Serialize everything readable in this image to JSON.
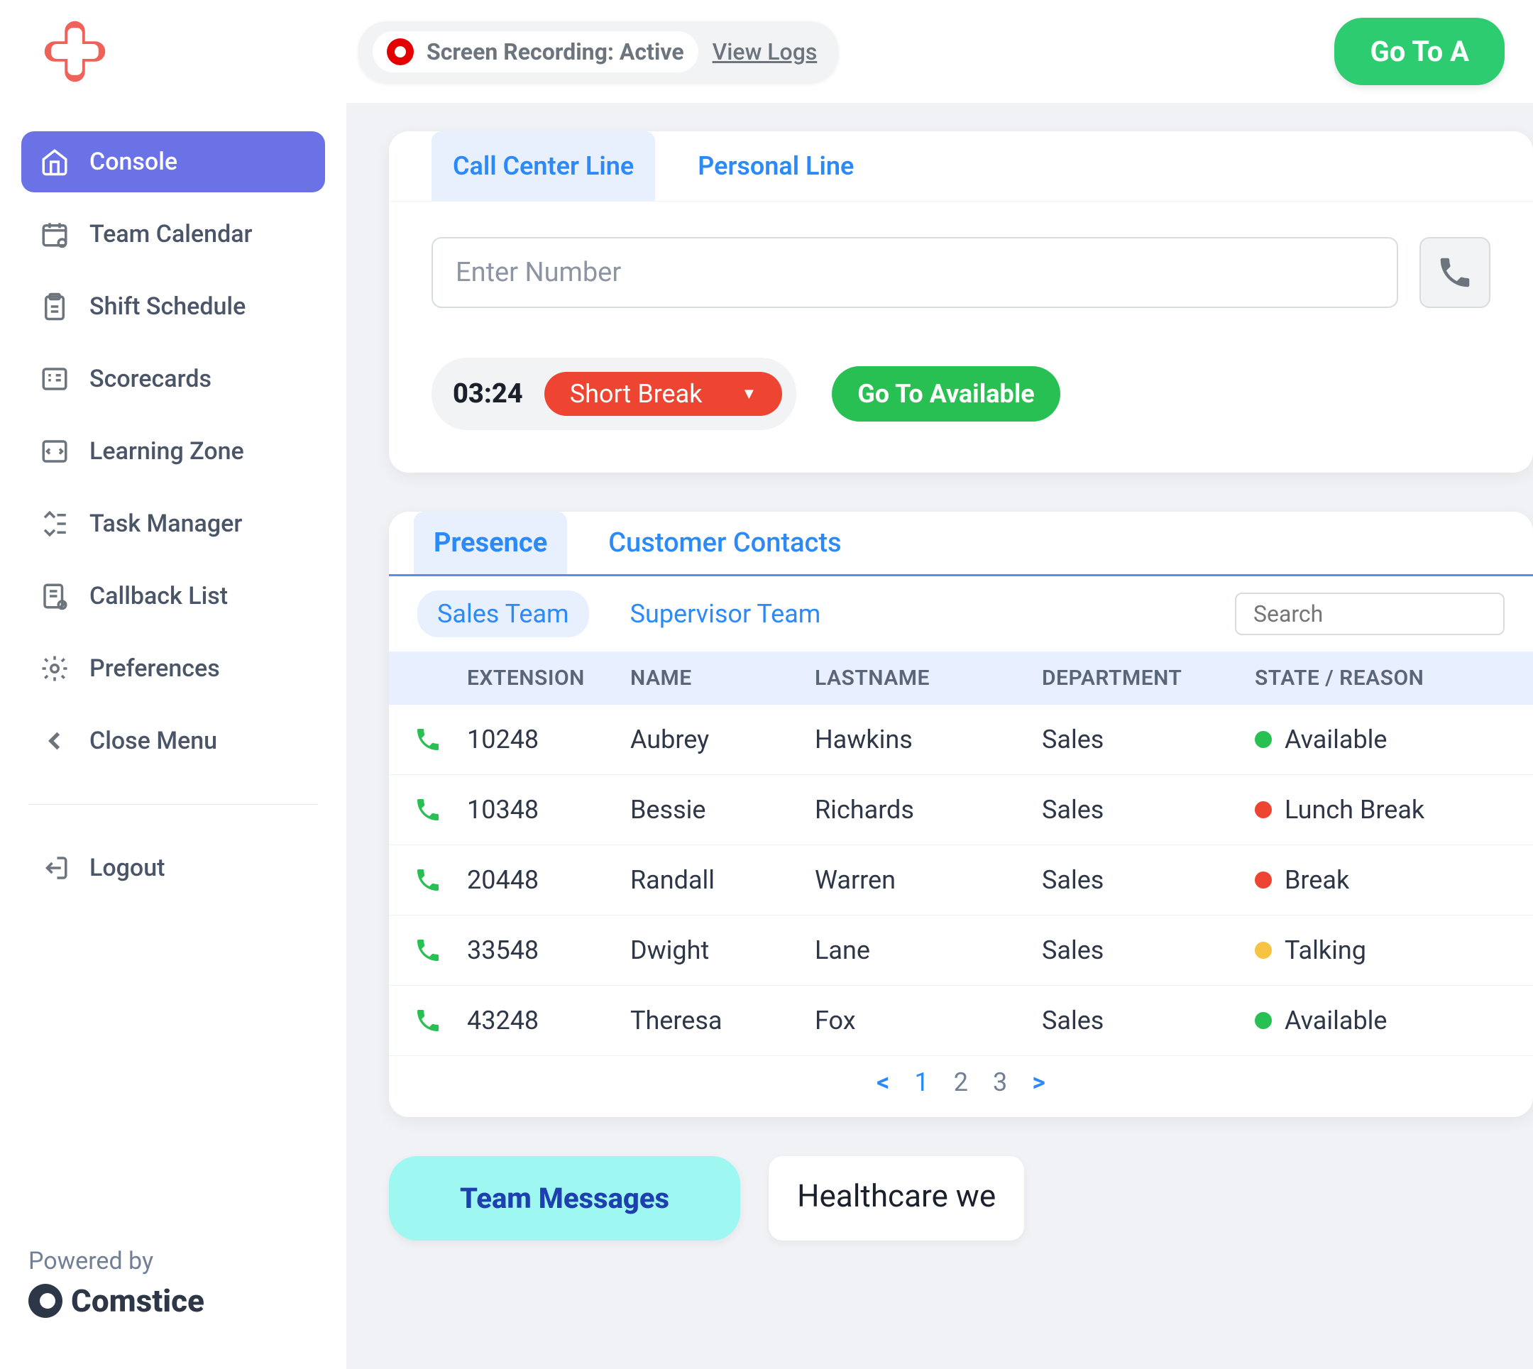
{
  "topbar": {
    "recording_text": "Screen Recording: Active",
    "view_logs": "View Logs",
    "goto_a": "Go To A"
  },
  "sidebar": {
    "items": [
      {
        "label": "Console",
        "icon": "home"
      },
      {
        "label": "Team Calendar",
        "icon": "calendar"
      },
      {
        "label": "Shift Schedule",
        "icon": "clipboard"
      },
      {
        "label": "Scorecards",
        "icon": "score"
      },
      {
        "label": "Learning Zone",
        "icon": "learn"
      },
      {
        "label": "Task Manager",
        "icon": "task"
      },
      {
        "label": "Callback List",
        "icon": "callback"
      },
      {
        "label": "Preferences",
        "icon": "gear"
      },
      {
        "label": "Close Menu",
        "icon": "chevron-left"
      }
    ],
    "logout": "Logout",
    "powered_by": "Powered by",
    "brand": "Comstice"
  },
  "dialer": {
    "tabs": {
      "call_center": "Call Center Line",
      "personal": "Personal Line"
    },
    "placeholder": "Enter Number",
    "time": "03:24",
    "status_label": "Short Break",
    "go_available": "Go To Available"
  },
  "presence": {
    "tabs": {
      "presence": "Presence",
      "contacts": "Customer Contacts"
    },
    "teams": {
      "sales": "Sales Team",
      "supervisor": "Supervisor Team"
    },
    "search_placeholder": "Search",
    "headers": {
      "extension": "EXTENSION",
      "name": "NAME",
      "lastname": "LASTNAME",
      "department": "DEPARTMENT",
      "state": "STATE / REASON"
    },
    "rows": [
      {
        "ext": "10248",
        "name": "Aubrey",
        "last": "Hawkins",
        "dept": "Sales",
        "state": "Available",
        "dot": "green"
      },
      {
        "ext": "10348",
        "name": "Bessie",
        "last": "Richards",
        "dept": "Sales",
        "state": "Lunch Break",
        "dot": "red"
      },
      {
        "ext": "20448",
        "name": "Randall",
        "last": "Warren",
        "dept": "Sales",
        "state": "Break",
        "dot": "red"
      },
      {
        "ext": "33548",
        "name": "Dwight",
        "last": "Lane",
        "dept": "Sales",
        "state": "Talking",
        "dot": "yellow"
      },
      {
        "ext": "43248",
        "name": "Theresa",
        "last": "Fox",
        "dept": "Sales",
        "state": "Available",
        "dot": "green"
      }
    ],
    "pagination": {
      "prev": "<",
      "p1": "1",
      "p2": "2",
      "p3": "3",
      "next": ">"
    }
  },
  "messages": {
    "team_messages": "Team Messages",
    "healthcare": "Healthcare we"
  }
}
